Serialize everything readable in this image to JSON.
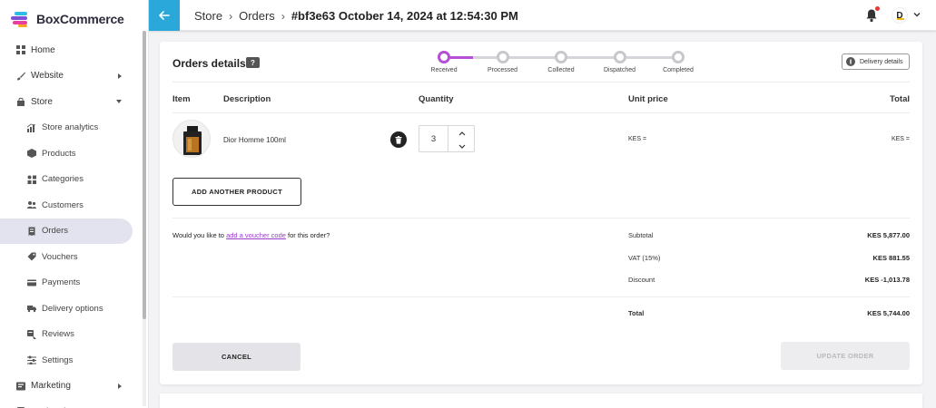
{
  "brand": {
    "name": "BoxCommerce",
    "colors": {
      "accent": "#b450d4",
      "header_back": "#29a8d9",
      "logo": [
        "#2dbbe8",
        "#7b4fd6",
        "#e63fa0",
        "#f6a623"
      ]
    }
  },
  "sidebar": {
    "items": [
      {
        "label": "Home",
        "icon": "home-icon",
        "level": "top"
      },
      {
        "label": "Website",
        "icon": "brush-icon",
        "level": "top",
        "caret": "right"
      },
      {
        "label": "Store",
        "icon": "store-icon",
        "level": "top",
        "caret": "down"
      },
      {
        "label": "Store analytics",
        "icon": "analytics-icon",
        "level": "sub"
      },
      {
        "label": "Products",
        "icon": "box-icon",
        "level": "sub"
      },
      {
        "label": "Categories",
        "icon": "categories-icon",
        "level": "sub"
      },
      {
        "label": "Customers",
        "icon": "people-icon",
        "level": "sub"
      },
      {
        "label": "Orders",
        "icon": "orders-icon",
        "level": "sub",
        "active": true
      },
      {
        "label": "Vouchers",
        "icon": "tag-icon",
        "level": "sub"
      },
      {
        "label": "Payments",
        "icon": "card-icon",
        "level": "sub"
      },
      {
        "label": "Delivery options",
        "icon": "truck-icon",
        "level": "sub"
      },
      {
        "label": "Reviews",
        "icon": "reviews-icon",
        "level": "sub"
      },
      {
        "label": "Settings",
        "icon": "sliders-icon",
        "level": "sub"
      },
      {
        "label": "Marketing",
        "icon": "marketing-icon",
        "level": "top",
        "caret": "right"
      },
      {
        "label": "Marketplace",
        "icon": "marketplace-icon",
        "level": "top",
        "caret": "right"
      }
    ]
  },
  "header": {
    "breadcrumb": [
      "Store",
      "Orders"
    ],
    "current": "#bf3e63 October 14, 2024 at 12:54:30 PM",
    "avatar_letter": "D"
  },
  "order": {
    "title": "Orders details",
    "help": "?",
    "steps": [
      "Received",
      "Processed",
      "Collected",
      "Dispatched",
      "Completed"
    ],
    "active_step": 0,
    "delivery_button": "Delivery details",
    "columns": {
      "item": "Item",
      "description": "Description",
      "quantity": "Quantity",
      "unit_price": "Unit price",
      "total": "Total"
    },
    "line": {
      "name": "Dior Homme 100ml",
      "quantity": "3",
      "unit_price": "KES =",
      "total": "KES ="
    },
    "add_button": "ADD ANOTHER PRODUCT",
    "voucher": {
      "prefix": "Would you like to ",
      "link": "add a voucher code",
      "suffix": " for this order?"
    },
    "summary": {
      "subtotal_label": "Subtotal",
      "subtotal": "KES 5,877.00",
      "vat_label": "VAT (15%)",
      "vat": "KES 881.55",
      "discount_label": "Discount",
      "discount": "KES -1,013.78",
      "total_label": "Total",
      "total": "KES 5,744.00"
    },
    "cancel_button": "CANCEL",
    "update_button": "UPDATE ORDER"
  }
}
